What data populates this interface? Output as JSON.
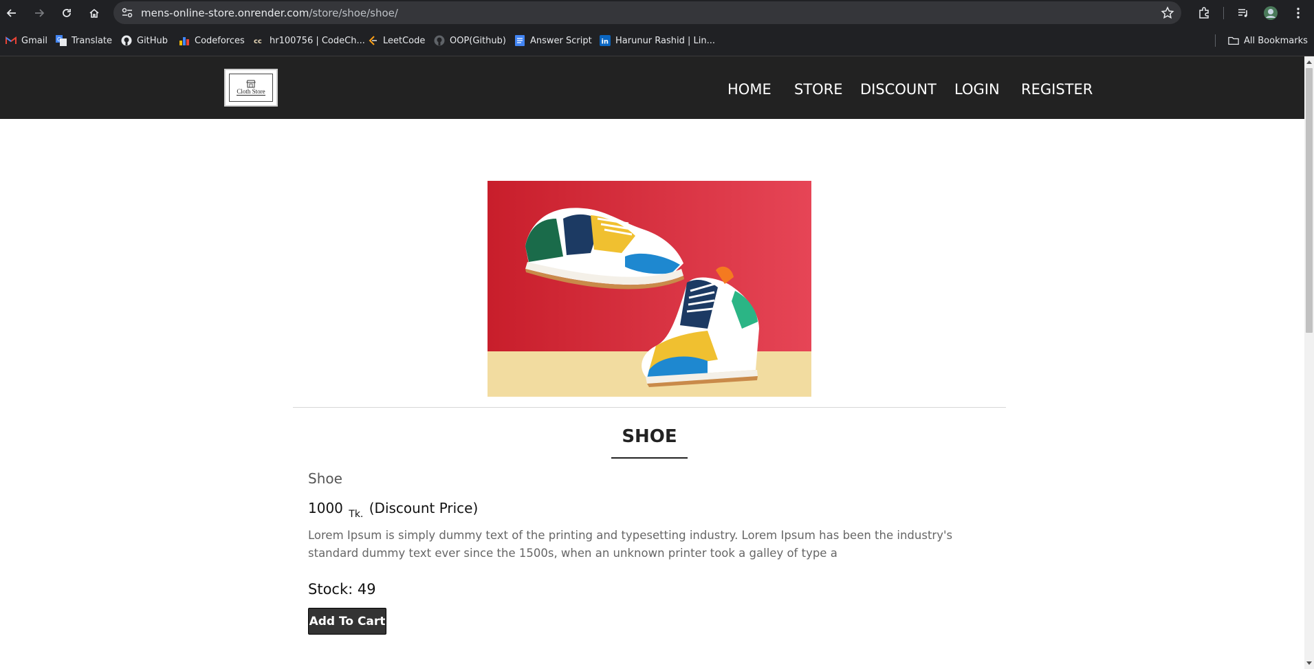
{
  "browser": {
    "url_host": "mens-online-store.onrender.com",
    "url_path": "/store/shoe/shoe/",
    "bookmarks": [
      {
        "label": "Gmail",
        "icon": "gmail-icon"
      },
      {
        "label": "Translate",
        "icon": "translate-icon"
      },
      {
        "label": "GitHub",
        "icon": "github-icon"
      },
      {
        "label": "Codeforces",
        "icon": "codeforces-icon"
      },
      {
        "label": "hr100756 | CodeCh...",
        "icon": "codechef-icon"
      },
      {
        "label": "LeetCode",
        "icon": "leetcode-icon"
      },
      {
        "label": "OOP(Github)",
        "icon": "github-icon"
      },
      {
        "label": "Answer Script",
        "icon": "docs-icon"
      },
      {
        "label": "Harunur Rashid | Lin...",
        "icon": "linkedin-icon"
      }
    ],
    "all_bookmarks": "All Bookmarks"
  },
  "site": {
    "logo_text": "Cloth Store",
    "nav": [
      "HOME",
      "STORE",
      "DISCOUNT",
      "LOGIN",
      "REGISTER"
    ]
  },
  "product": {
    "title": "SHOE",
    "subtitle": "Shoe",
    "price_value": "1000",
    "price_currency": "Tk.",
    "price_note": "(Discount Price)",
    "description": "Lorem Ipsum is simply dummy text of the printing and typesetting industry. Lorem Ipsum has been the industry's standard dummy text ever since the 1500s, when an unknown printer took a galley of type a",
    "stock": "Stock: 49",
    "add_to_cart": "Add To Cart"
  },
  "colors": {
    "header_bg": "#222222",
    "button_bg": "#333333",
    "image_bg_top": "#d42a35",
    "image_bg_floor": "#f2dca0"
  }
}
